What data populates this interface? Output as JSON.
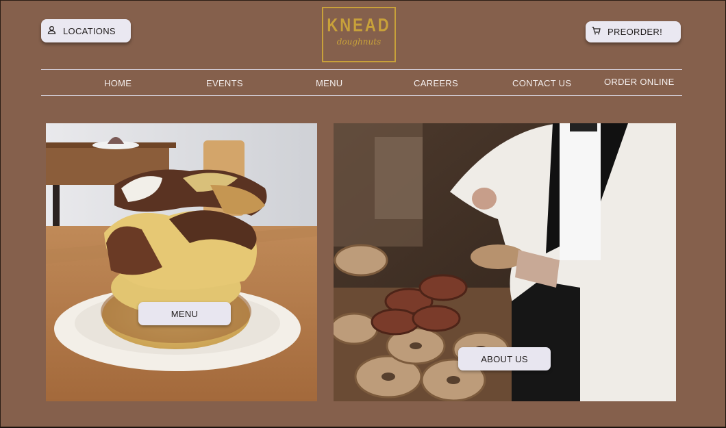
{
  "header": {
    "locations_label": "LOCATIONS",
    "preorder_label": "PREORDER!",
    "logo": {
      "word": "KNEAD",
      "sub": "doughnuts"
    }
  },
  "nav": {
    "items": [
      "HOME",
      "EVENTS",
      "MENU",
      "CAREERS",
      "CONTACT US",
      "ORDER ONLINE"
    ]
  },
  "tiles": {
    "menu_label": "MENU",
    "about_label": "ABOUT US"
  },
  "colors": {
    "background": "#85604c",
    "button_bg": "#eae8f1",
    "logo_gold": "#c8a13a",
    "nav_text": "#f5efee"
  },
  "icons": {
    "locations": "user-pin-icon",
    "preorder": "cart-icon"
  }
}
